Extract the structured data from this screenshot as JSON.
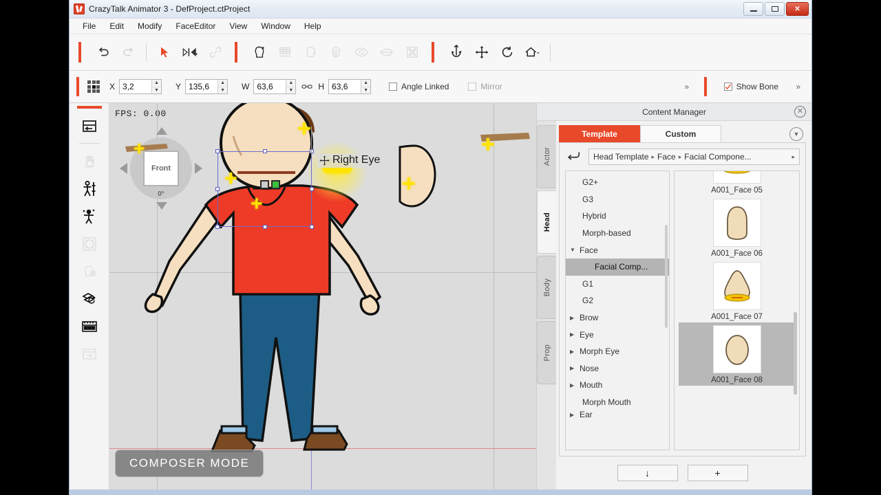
{
  "window": {
    "title": "CrazyTalk Animator 3   - DefProject.ctProject",
    "app_icon": "crazytalk-logo-icon",
    "controls": {
      "minimize": "–",
      "maximize": "▫",
      "close": "✕"
    }
  },
  "menubar": {
    "items": [
      "File",
      "Edit",
      "Modify",
      "FaceEditor",
      "View",
      "Window",
      "Help"
    ]
  },
  "toolbar": {
    "groups": [
      {
        "name": "history",
        "buttons": [
          {
            "label": "Undo",
            "icon": "undo-icon",
            "enabled": true
          },
          {
            "label": "Redo",
            "icon": "redo-icon",
            "enabled": false
          }
        ]
      },
      {
        "name": "select",
        "buttons": [
          {
            "label": "Select Tool",
            "icon": "arrow-cursor-icon",
            "enabled": true
          },
          {
            "label": "Transform Flip",
            "icon": "flip-icon",
            "enabled": true
          },
          {
            "label": "Link",
            "icon": "link-icon",
            "enabled": false
          }
        ]
      },
      {
        "name": "face",
        "buttons": [
          {
            "label": "Face Setup",
            "icon": "head-sparkle-icon",
            "enabled": true
          },
          {
            "label": "Sprite Editor",
            "icon": "sprite-grid-icon",
            "enabled": false
          },
          {
            "label": "Head Profile",
            "icon": "head-profile-icon",
            "enabled": false
          },
          {
            "label": "Head Pivot",
            "icon": "head-pivot-icon",
            "enabled": false
          },
          {
            "label": "Eye Setting",
            "icon": "eye-icon",
            "enabled": false
          },
          {
            "label": "Mouth Setting",
            "icon": "mouth-icon",
            "enabled": false
          },
          {
            "label": "Mesh Editor",
            "icon": "mesh-icon",
            "enabled": false
          }
        ]
      },
      {
        "name": "transform",
        "buttons": [
          {
            "label": "Pivot",
            "icon": "anchor-pivot-icon",
            "enabled": true
          },
          {
            "label": "Move",
            "icon": "move-cross-icon",
            "enabled": true
          },
          {
            "label": "Rotate",
            "icon": "rotate-icon",
            "enabled": true
          },
          {
            "label": "Home",
            "icon": "home-icon",
            "enabled": true
          }
        ]
      }
    ]
  },
  "properties": {
    "anchor_icon": "anchor-grid-icon",
    "fields": [
      {
        "label": "X",
        "value": "3,2"
      },
      {
        "label": "Y",
        "value": "135,6"
      },
      {
        "label": "W",
        "value": "63,6"
      },
      {
        "label": "H",
        "value": "63,6"
      }
    ],
    "aspect_link_icon": "chain-link-icon",
    "angle_linked": {
      "label": "Angle Linked",
      "checked": false,
      "enabled": true
    },
    "mirror": {
      "label": "Mirror",
      "checked": false,
      "enabled": false
    },
    "overflow_left": "»",
    "show_bone": {
      "label": "Show Bone",
      "checked": true
    },
    "overflow_right": "»"
  },
  "rail": {
    "items": [
      {
        "name": "stage-layout",
        "icon": "panel-layout-icon",
        "enabled": true
      },
      {
        "name": "motion-hand",
        "icon": "hand-g123-icon",
        "enabled": false
      },
      {
        "name": "character-bone",
        "icon": "character-bone-icon",
        "enabled": true
      },
      {
        "name": "bone-editor",
        "icon": "bone-edit-icon",
        "enabled": true
      },
      {
        "name": "sprite-mesh",
        "icon": "sprite-mesh-icon",
        "enabled": false
      },
      {
        "name": "head-sprite",
        "icon": "head-sprite-icon",
        "enabled": false
      },
      {
        "name": "sprite-swap",
        "icon": "layer-swap-icon",
        "enabled": true
      },
      {
        "name": "key-editor",
        "icon": "key-grid-icon",
        "enabled": true
      },
      {
        "name": "export-panel",
        "icon": "export-icon",
        "enabled": false
      }
    ]
  },
  "stage": {
    "fps_label": "FPS: 0.00",
    "view_cube": {
      "face_label": "Front",
      "degrees": "0°"
    },
    "mode_badge": "COMPOSER MODE",
    "tooltip": {
      "label": "Right Eye",
      "icon": "move-cursor-icon"
    },
    "selection": {
      "visible": true
    }
  },
  "content_manager": {
    "title": "Content Manager",
    "close_icon": "close-circle-icon",
    "vertical_tabs": [
      {
        "label": "Actor",
        "active": false
      },
      {
        "label": "Head",
        "active": true
      },
      {
        "label": "Body",
        "active": false
      },
      {
        "label": "Prop",
        "active": false
      }
    ],
    "tabs": [
      {
        "label": "Template",
        "active": true
      },
      {
        "label": "Custom",
        "active": false
      }
    ],
    "collapse_icon": "chevron-down-circle-icon",
    "back_icon": "back-arrow-icon",
    "breadcrumb": [
      "Head Template",
      "Face",
      "Facial Compone..."
    ],
    "breadcrumb_separator": "▸",
    "tree": [
      {
        "label": "G2+",
        "indent": 1,
        "arrow": "",
        "selected": false
      },
      {
        "label": "G3",
        "indent": 1,
        "arrow": "",
        "selected": false
      },
      {
        "label": "Hybrid",
        "indent": 1,
        "arrow": "",
        "selected": false
      },
      {
        "label": "Morph-based",
        "indent": 1,
        "arrow": "",
        "selected": false
      },
      {
        "label": "Face",
        "indent": 0,
        "arrow": "▼",
        "selected": false
      },
      {
        "label": "Facial Comp...",
        "indent": 2,
        "arrow": "",
        "selected": true
      },
      {
        "label": "G1",
        "indent": 1,
        "arrow": "",
        "selected": false
      },
      {
        "label": "G2",
        "indent": 1,
        "arrow": "",
        "selected": false
      },
      {
        "label": "Brow",
        "indent": 0,
        "arrow": "▶",
        "selected": false
      },
      {
        "label": "Eye",
        "indent": 0,
        "arrow": "▶",
        "selected": false
      },
      {
        "label": "Morph Eye",
        "indent": 0,
        "arrow": "▶",
        "selected": false
      },
      {
        "label": "Nose",
        "indent": 0,
        "arrow": "▶",
        "selected": false
      },
      {
        "label": "Mouth",
        "indent": 0,
        "arrow": "▶",
        "selected": false
      },
      {
        "label": "Morph Mouth",
        "indent": 1,
        "arrow": "",
        "selected": false
      },
      {
        "label": "Ear",
        "indent": 0,
        "arrow": "▶",
        "selected": false
      }
    ],
    "thumbnails": [
      {
        "caption": "A001_Face 05",
        "shape": "face-wide-mouth",
        "selected": false,
        "clipped_top": true
      },
      {
        "caption": "A001_Face 06",
        "shape": "face-tall-rounded",
        "selected": false
      },
      {
        "caption": "A001_Face 07",
        "shape": "face-triangular-mouth",
        "selected": false
      },
      {
        "caption": "A001_Face 08",
        "shape": "face-oval",
        "selected": true
      }
    ],
    "footer_buttons": [
      {
        "label": "↓",
        "name": "download-button"
      },
      {
        "label": "+",
        "name": "add-button"
      }
    ]
  },
  "colors": {
    "accent_red": "#e8492b",
    "title_close": "#c62b14",
    "selection_blue": "#6b6bc8",
    "marker_yellow": "#FFE400",
    "shirt_red": "#ee3b27",
    "pants_blue": "#1d5d85",
    "skin": "#f6dfc0",
    "hair_brown": "#6b3a16"
  }
}
